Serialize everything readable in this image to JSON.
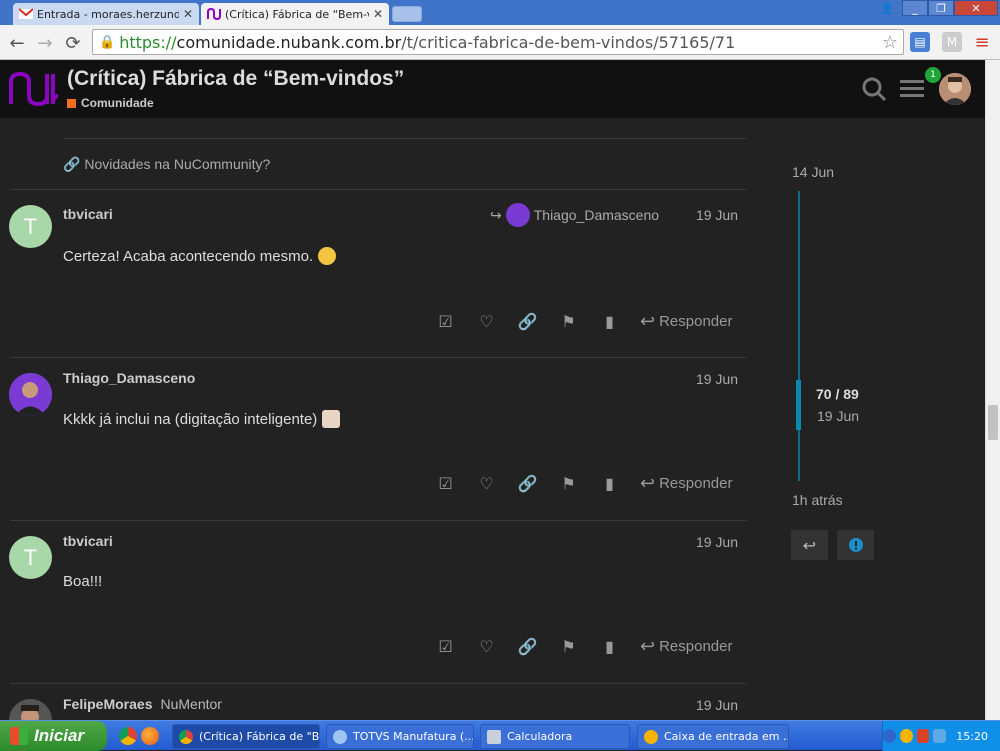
{
  "browser": {
    "tabs": [
      {
        "title": "Entrada - moraes.herzundve",
        "icon": "gmail-icon",
        "active": false
      },
      {
        "title": "(Crítica) Fábrica de “Bem-vin",
        "icon": "nubank-icon",
        "active": true
      }
    ],
    "url_scheme": "https://",
    "url_host": "comunidade.nubank.com.br",
    "url_path": "/t/critica-fabrica-de-bem-vindos/57165/71"
  },
  "header": {
    "title": "(Crítica) Fábrica de “Bem-vindos”",
    "category": "Comunidade",
    "category_color": "#f26f21",
    "notification_count": "1"
  },
  "related_link": "Novidades na NuCommunity?",
  "posts": [
    {
      "user": "tbvicari",
      "user_title": "",
      "avatar_letter": "T",
      "reply_to": "Thiago_Damasceno",
      "date": "19 Jun",
      "body": "Certeza! Acaba acontecendo mesmo.",
      "reply_label": "Responder"
    },
    {
      "user": "Thiago_Damasceno",
      "user_title": "",
      "avatar_letter": "",
      "reply_to": "",
      "date": "19 Jun",
      "body": "Kkkk já inclui na (digitação inteligente)",
      "reply_label": "Responder"
    },
    {
      "user": "tbvicari",
      "user_title": "",
      "avatar_letter": "T",
      "reply_to": "",
      "date": "19 Jun",
      "body": "Boa!!!",
      "reply_label": "Responder"
    },
    {
      "user": "FelipeMoraes",
      "user_title": "NuMentor",
      "avatar_letter": "",
      "reply_to": "",
      "date": "19 Jun",
      "body": "",
      "reply_label": ""
    }
  ],
  "timeline": {
    "start_date": "14 Jun",
    "position": "70 / 89",
    "position_date": "19 Jun",
    "end_label": "1h atrás"
  },
  "taskbar": {
    "start_label": "Iniciar",
    "items": [
      {
        "label": "(Crítica) Fábrica de \"B...",
        "active": true
      },
      {
        "label": "TOTVS Manufatura (...",
        "active": false
      },
      {
        "label": "Calculadora",
        "active": false
      },
      {
        "label": "Caixa de entrada em ...",
        "active": false
      }
    ],
    "clock": "15:20"
  }
}
